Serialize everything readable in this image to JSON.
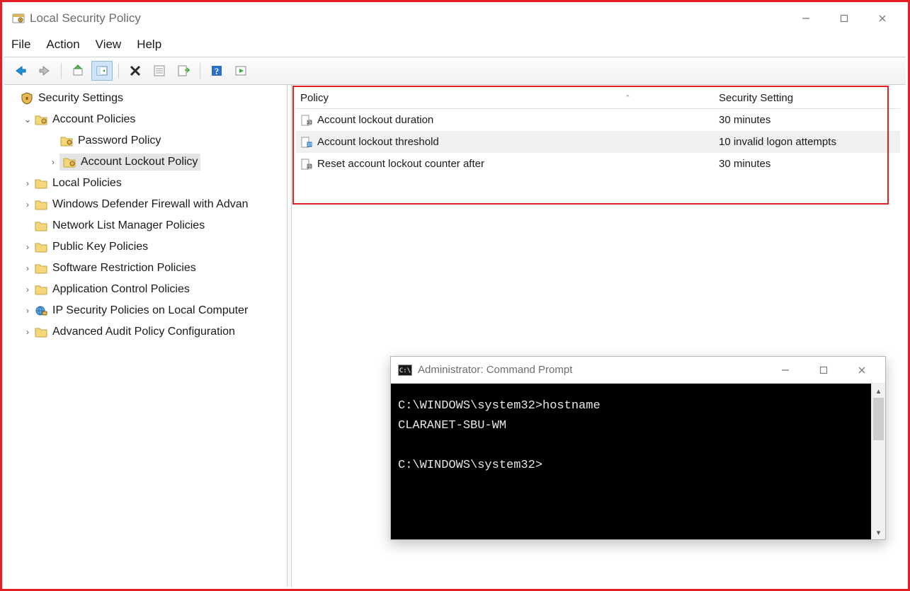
{
  "window": {
    "title": "Local Security Policy"
  },
  "menu": {
    "file": "File",
    "action": "Action",
    "view": "View",
    "help": "Help"
  },
  "tree": {
    "root": "Security Settings",
    "account_policies": "Account Policies",
    "password_policy": "Password Policy",
    "account_lockout_policy": "Account Lockout Policy",
    "local_policies": "Local Policies",
    "firewall": "Windows Defender Firewall with Advan",
    "network_list": "Network List Manager Policies",
    "public_key": "Public Key Policies",
    "software_restriction": "Software Restriction Policies",
    "app_control": "Application Control Policies",
    "ipsec": "IP Security Policies on Local Computer",
    "audit": "Advanced Audit Policy Configuration"
  },
  "list": {
    "header_policy": "Policy",
    "header_setting": "Security Setting",
    "rows": [
      {
        "policy": "Account lockout duration",
        "setting": "30 minutes"
      },
      {
        "policy": "Account lockout threshold",
        "setting": "10 invalid logon attempts"
      },
      {
        "policy": "Reset account lockout counter after",
        "setting": "30 minutes"
      }
    ]
  },
  "cmd": {
    "title": "Administrator: Command Prompt",
    "line1": "C:\\WINDOWS\\system32>hostname",
    "line2": "CLARANET-SBU-WM",
    "line3": "",
    "line4": "C:\\WINDOWS\\system32>"
  }
}
